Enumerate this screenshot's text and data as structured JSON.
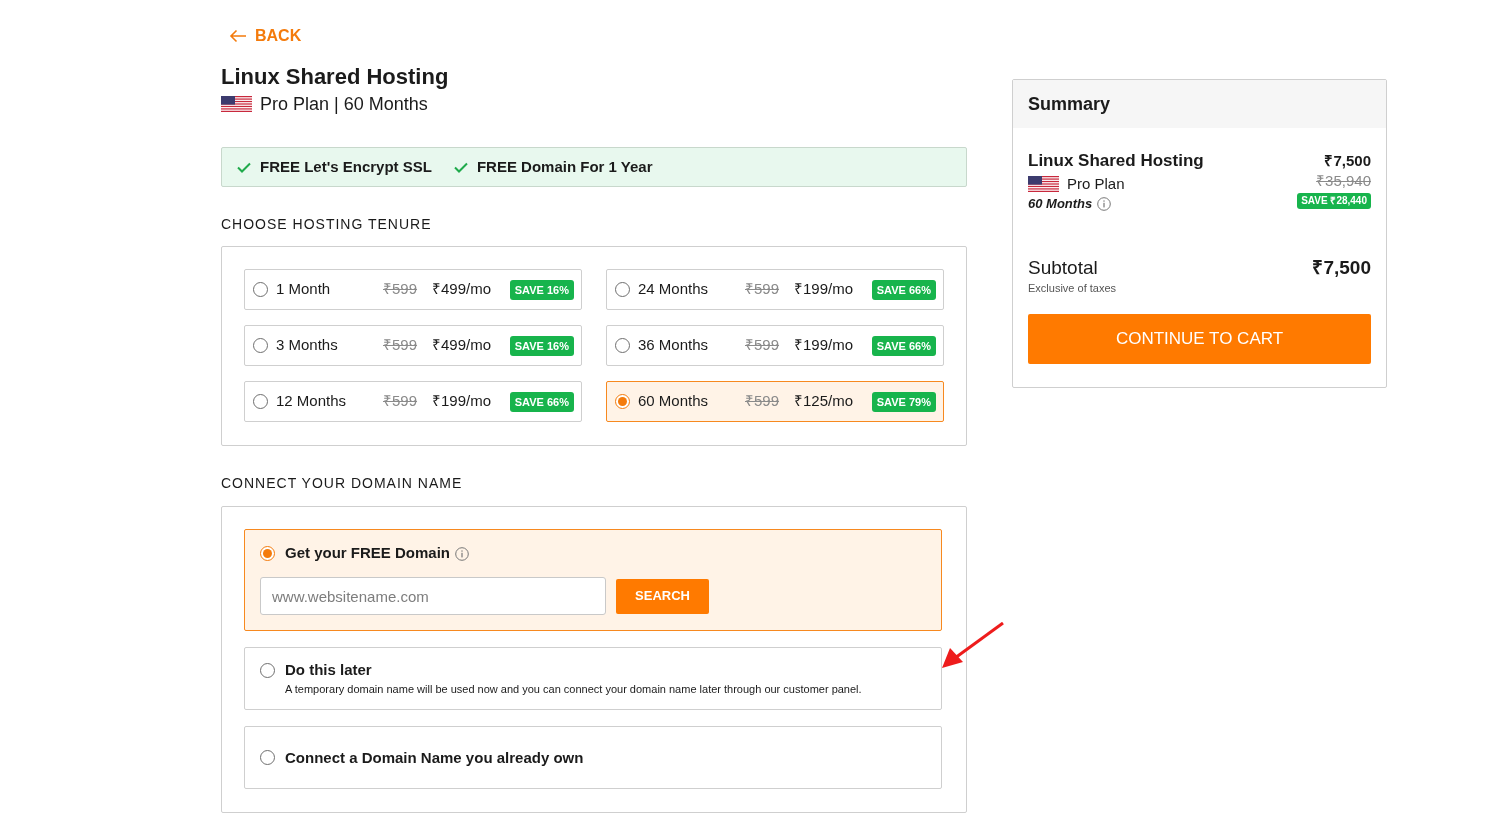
{
  "back_link": {
    "label": "BACK"
  },
  "product": {
    "title": "Linux Shared Hosting",
    "subtitle": "Pro Plan | 60 Months"
  },
  "features": [
    "FREE Let's Encrypt SSL",
    "FREE Domain For 1 Year"
  ],
  "tenure": {
    "heading": "CHOOSE HOSTING TENURE",
    "options": [
      {
        "label": "1 Month",
        "original_price": "₹599",
        "price": "₹499/mo",
        "savings": "SAVE 16%",
        "selected": false
      },
      {
        "label": "3 Months",
        "original_price": "₹599",
        "price": "₹499/mo",
        "savings": "SAVE 16%",
        "selected": false
      },
      {
        "label": "12 Months",
        "original_price": "₹599",
        "price": "₹199/mo",
        "savings": "SAVE 66%",
        "selected": false
      },
      {
        "label": "24 Months",
        "original_price": "₹599",
        "price": "₹199/mo",
        "savings": "SAVE 66%",
        "selected": false
      },
      {
        "label": "36 Months",
        "original_price": "₹599",
        "price": "₹199/mo",
        "savings": "SAVE 66%",
        "selected": false
      },
      {
        "label": "60 Months",
        "original_price": "₹599",
        "price": "₹125/mo",
        "savings": "SAVE 79%",
        "selected": true
      }
    ]
  },
  "domain": {
    "heading": "CONNECT YOUR DOMAIN NAME",
    "options": [
      {
        "kind": "search",
        "label": "Get your FREE Domain",
        "selected": true,
        "placeholder": "www.websitename.com",
        "button": "SEARCH"
      },
      {
        "kind": "plain",
        "label": "Do this later",
        "description": "A temporary domain name will be used now and you can connect your domain name later through our customer panel.",
        "selected": false
      },
      {
        "kind": "plain",
        "label": "Connect a Domain Name you already own",
        "selected": false
      }
    ]
  },
  "summary": {
    "title": "Summary",
    "item": {
      "name": "Linux Shared Hosting",
      "plan": "Pro Plan",
      "term": "60 Months",
      "price": "₹7,500",
      "original_price": "₹35,940",
      "savings": "SAVE ₹28,440"
    },
    "subtotal": {
      "label": "Subtotal",
      "amount": "₹7,500",
      "note": "Exclusive of taxes"
    },
    "button": "CONTINUE TO CART"
  }
}
